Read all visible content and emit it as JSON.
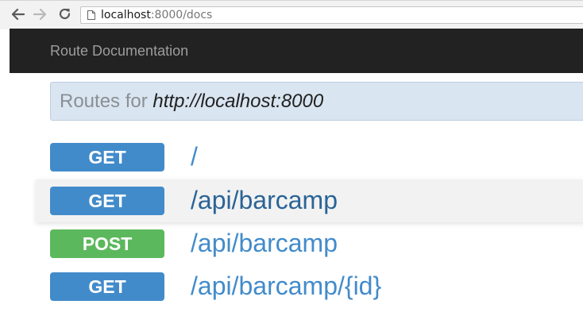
{
  "browser": {
    "address": {
      "host": "localhost",
      "path": ":8000/docs"
    },
    "icons": {
      "back": "arrow-left-icon",
      "forward": "arrow-right-icon",
      "reload": "reload-icon",
      "page": "page-icon"
    }
  },
  "navbar": {
    "brand": "Route Documentation"
  },
  "routes_header": {
    "label": "Routes for",
    "url": "http://localhost:8000"
  },
  "routes": [
    {
      "method": "GET",
      "path": "/"
    },
    {
      "method": "GET",
      "path": "/api/barcamp"
    },
    {
      "method": "POST",
      "path": "/api/barcamp"
    },
    {
      "method": "GET",
      "path": "/api/barcamp/{id}"
    }
  ],
  "colors": {
    "get": "#428bca",
    "post": "#5cb85c",
    "navbar": "#222222",
    "link": "#428bca"
  }
}
